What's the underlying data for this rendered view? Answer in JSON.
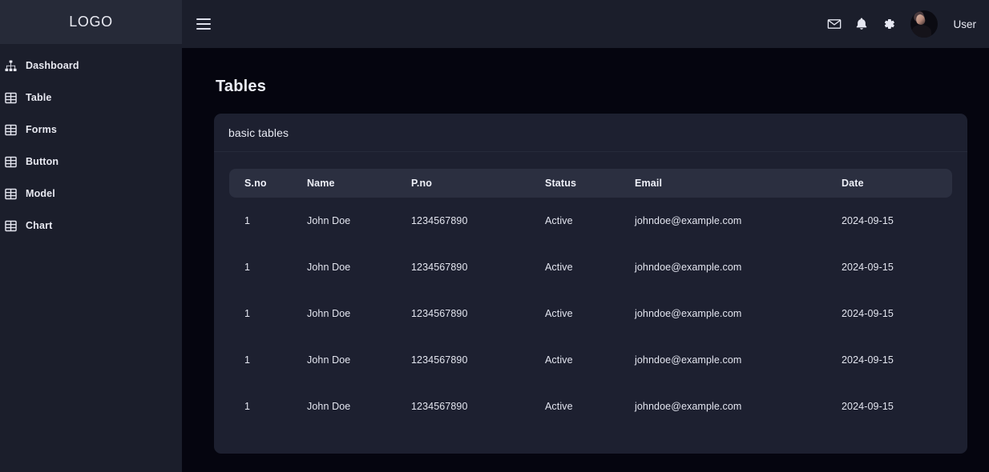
{
  "sidebar": {
    "logo": "LOGO",
    "items": [
      {
        "label": "Dashboard",
        "icon": "sitemap-icon"
      },
      {
        "label": "Table",
        "icon": "table-grid-icon"
      },
      {
        "label": "Forms",
        "icon": "table-grid-icon"
      },
      {
        "label": "Button",
        "icon": "table-grid-icon"
      },
      {
        "label": "Model",
        "icon": "table-grid-icon"
      },
      {
        "label": "Chart",
        "icon": "table-grid-icon"
      }
    ]
  },
  "topbar": {
    "menu_icon": "hamburger-icon",
    "icons": [
      {
        "name": "mail-icon"
      },
      {
        "name": "bell-icon"
      },
      {
        "name": "gear-icon"
      }
    ],
    "avatar": "user-avatar",
    "user_label": "User"
  },
  "main": {
    "page_title": "Tables",
    "card": {
      "header_title": "basic tables",
      "table": {
        "columns": [
          "S.no",
          "Name",
          "P.no",
          "Status",
          "Email",
          "Date"
        ],
        "rows": [
          [
            "1",
            "John Doe",
            "1234567890",
            "Active",
            "johndoe@example.com",
            "2024-09-15"
          ],
          [
            "1",
            "John Doe",
            "1234567890",
            "Active",
            "johndoe@example.com",
            "2024-09-15"
          ],
          [
            "1",
            "John Doe",
            "1234567890",
            "Active",
            "johndoe@example.com",
            "2024-09-15"
          ],
          [
            "1",
            "John Doe",
            "1234567890",
            "Active",
            "johndoe@example.com",
            "2024-09-15"
          ],
          [
            "1",
            "John Doe",
            "1234567890",
            "Active",
            "johndoe@example.com",
            "2024-09-15"
          ]
        ]
      }
    }
  },
  "colors": {
    "page_bg": "#05050f",
    "sidebar_bg": "#1b1e2b",
    "sidebar_logo_bg": "#262a38",
    "topbar_bg": "#1b1e2b",
    "card_bg": "#1d2030",
    "table_head_bg": "#2b2f40",
    "text_primary": "#e8e9f1"
  }
}
